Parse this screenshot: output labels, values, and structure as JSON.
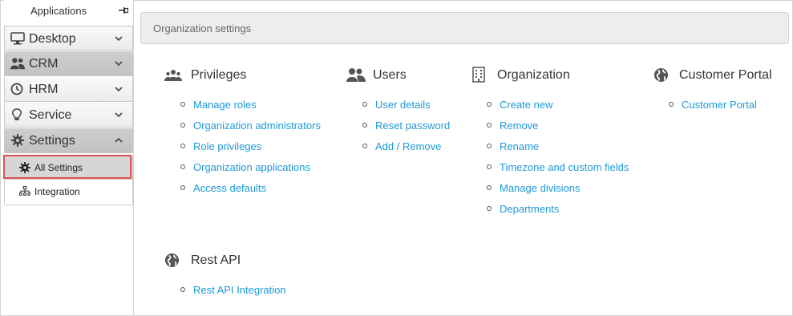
{
  "sidebar": {
    "title": "Applications",
    "items": [
      {
        "label": "Desktop",
        "icon": "monitor-icon"
      },
      {
        "label": "CRM",
        "icon": "users-icon"
      },
      {
        "label": "HRM",
        "icon": "clock-icon"
      },
      {
        "label": "Service",
        "icon": "lightbulb-icon"
      },
      {
        "label": "Settings",
        "icon": "gear-icon"
      }
    ],
    "sub_items": [
      {
        "label": "All Settings",
        "icon": "gear-icon"
      },
      {
        "label": "Integration",
        "icon": "sitemap-icon"
      }
    ]
  },
  "breadcrumb": "Organization settings",
  "sections": {
    "privileges": {
      "title": "Privileges",
      "icon": "group-icon",
      "links": [
        "Manage roles",
        "Organization administrators",
        "Role privileges",
        "Organization applications",
        "Access defaults"
      ]
    },
    "users": {
      "title": "Users",
      "icon": "users-icon",
      "links": [
        "User details",
        "Reset password",
        "Add / Remove"
      ]
    },
    "organization": {
      "title": "Organization",
      "icon": "building-icon",
      "links": [
        "Create new",
        "Remove",
        "Rename",
        "Timezone and custom fields",
        "Manage divisions",
        "Departments"
      ]
    },
    "customer_portal": {
      "title": "Customer Portal",
      "icon": "globe-icon",
      "links": [
        "Customer Portal"
      ]
    },
    "rest_api": {
      "title": "Rest API",
      "icon": "globe-icon",
      "links": [
        "Rest API Integration"
      ]
    }
  },
  "colors": {
    "link": "#1e9ad6",
    "highlight": "#e05353",
    "active_nav": "#c8c8c8"
  }
}
